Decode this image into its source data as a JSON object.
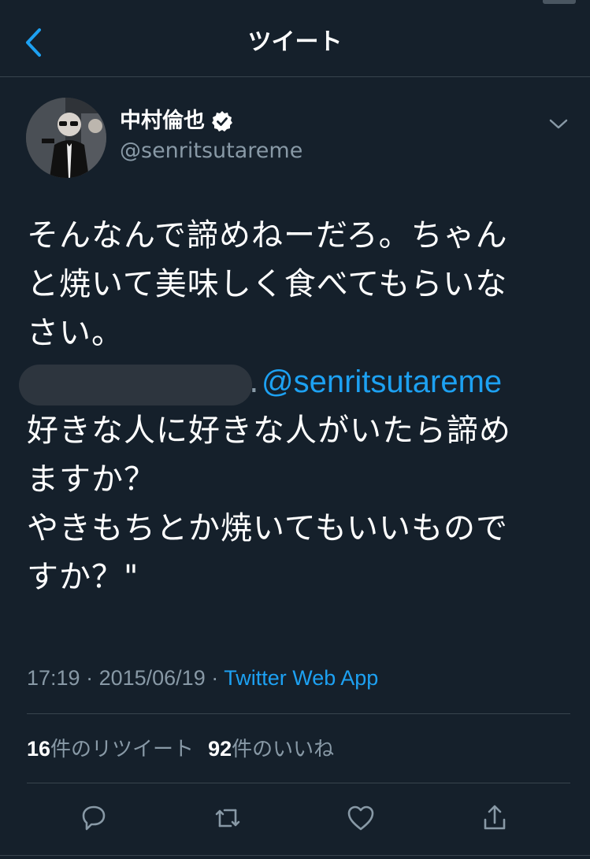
{
  "header": {
    "title": "ツイート",
    "back_icon": "chevron-left-icon"
  },
  "author": {
    "display_name": "中村倫也",
    "handle": "@senritsutareme",
    "verified": true
  },
  "tweet": {
    "text_lines": [
      "そんなんで諦めねーだろ。ちゃん",
      "と焼いて美味しく食べてもらいな",
      "さい。"
    ],
    "quote_prefix": ".",
    "quote_mention": "@senritsutareme",
    "quote_lines": [
      "好きな人に好きな人がいたら諦め",
      "ますか？",
      "やきもちとか焼いてもいいもので",
      "すか？\""
    ]
  },
  "meta": {
    "time": "17:19",
    "separator": " · ",
    "date": "2015/06/19",
    "source": "Twitter Web App"
  },
  "stats": {
    "retweets_count": "16",
    "retweets_label": "件のリツイート",
    "likes_count": "92",
    "likes_label": "件のいいね"
  },
  "actions": {
    "reply_icon": "reply-icon",
    "retweet_icon": "retweet-icon",
    "like_icon": "heart-icon",
    "share_icon": "share-icon"
  },
  "colors": {
    "background": "#15202b",
    "accent": "#1da1f2",
    "secondary_text": "#8899a6",
    "divider": "#38444d"
  }
}
